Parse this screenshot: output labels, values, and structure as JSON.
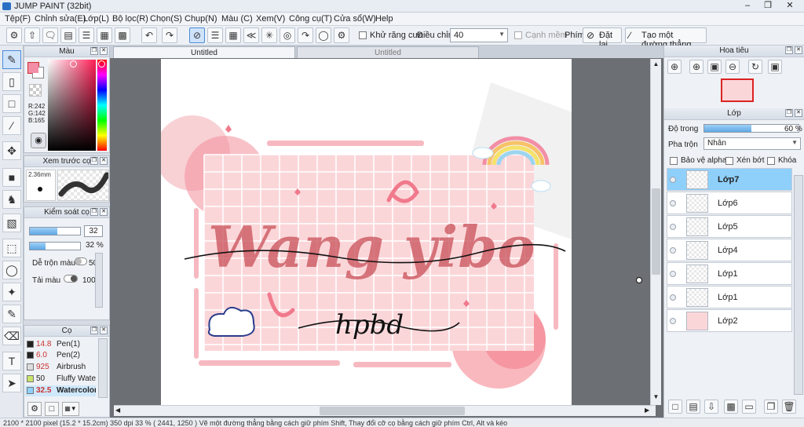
{
  "app": {
    "title": "JUMP PAINT (32bit)"
  },
  "menu": [
    "Tệp(F)",
    "Chỉnh sửa(E)",
    "Lớp(L)",
    "Bộ lọc(R)",
    "Chọn(S)",
    "Chụp(N)",
    "Màu (C)",
    "Xem(V)",
    "Công cụ(T)",
    "Cửa sổ(W)",
    "Help"
  ],
  "toolbar": {
    "antialias_label": "Khử răng cưa",
    "adjust_label": "Điều chỉnh",
    "adjust_value": "40",
    "edge_label": "Cạnh mềm",
    "key_label": "Phím",
    "reset_label": "Đặt lại",
    "line_label": "Tạo một đường thẳng"
  },
  "color_panel": {
    "title": "Màu",
    "r": "R:242",
    "g": "G:142",
    "b": "B:165",
    "fg_color": "#f28ea5"
  },
  "preview_panel": {
    "title": "Xem trước cọ",
    "size": "2.36mm"
  },
  "brush_control": {
    "title": "Kiểm soát cọ",
    "size_value": "32",
    "opacity_value": "32 %",
    "blend_label": "Dễ trộn màu",
    "blend_value": "50",
    "paint_label": "Tải màu",
    "paint_value": "100"
  },
  "brush_panel": {
    "title": "Cọ",
    "items": [
      {
        "size": "14.8",
        "name": "Pen(1)",
        "color": "#222222"
      },
      {
        "size": "6.0",
        "name": "Pen(2)",
        "color": "#222222"
      },
      {
        "size": "925",
        "name": "Airbrush",
        "color": "#dddddd"
      },
      {
        "size": "50",
        "name": "Fluffy Water",
        "color": "#c8e46a"
      },
      {
        "size": "32.5",
        "name": "Watercolor",
        "color": "#8fd0fb"
      }
    ]
  },
  "tabs": [
    "Untitled",
    "Untitled"
  ],
  "artwork": {
    "main_text": "Wang yibo",
    "sub_text": "hpbd"
  },
  "navigator": {
    "title": "Hoa tiêu"
  },
  "layers_panel": {
    "title": "Lớp",
    "opacity_label": "Độ trong",
    "opacity_value": "60 %",
    "blend_label": "Pha trộn",
    "blend_value": "Nhân",
    "protect_alpha": "Bảo vệ alpha",
    "clip": "Xén bớt",
    "lock": "Khóa",
    "layers": [
      "Lớp7",
      "Lớp6",
      "Lớp5",
      "Lớp4",
      "Lớp1",
      "Lớp1",
      "Lớp2"
    ]
  },
  "status": "2100 * 2100 pixel   (15.2 * 15.2cm)   350 dpi   33 %   ( 2441, 1250 )   Vẽ một đường thẳng bằng cách giữ phím Shift, Thay đổi cỡ cọ bằng cách giữ phím Ctrl, Alt và kéo"
}
